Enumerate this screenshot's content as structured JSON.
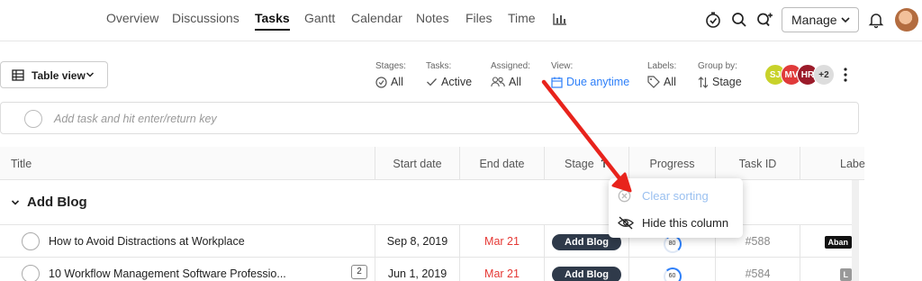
{
  "nav": {
    "tabs": [
      {
        "label": "Overview"
      },
      {
        "label": "Discussions"
      },
      {
        "label": "Tasks"
      },
      {
        "label": "Gantt"
      },
      {
        "label": "Calendar"
      },
      {
        "label": "Notes"
      },
      {
        "label": "Files"
      },
      {
        "label": "Time"
      }
    ],
    "active_tab": "Tasks",
    "manage_label": "Manage"
  },
  "toolbar": {
    "view_button": "Table view",
    "filters": [
      {
        "label": "Stages:",
        "value": "All",
        "icon": "check-circle-icon"
      },
      {
        "label": "Tasks:",
        "value": "Active",
        "icon": "check-icon"
      },
      {
        "label": "Assigned:",
        "value": "All",
        "icon": "users-icon"
      },
      {
        "label": "View:",
        "value": "Due anytime",
        "icon": "calendar-icon"
      },
      {
        "label": "Labels:",
        "value": "All",
        "icon": "tag-icon"
      },
      {
        "label": "Group by:",
        "value": "Stage",
        "icon": "sort-icon"
      }
    ],
    "avatars": [
      {
        "initials": "SJ",
        "color": "#c8d22a"
      },
      {
        "initials": "MV",
        "color": "#e03a3a"
      },
      {
        "initials": "HR",
        "color": "#9b1b2a"
      },
      {
        "initials": "+2",
        "color": "#dddddd"
      }
    ]
  },
  "add_task": {
    "placeholder": "Add task and hit enter/return key"
  },
  "table": {
    "headers": [
      "Title",
      "Start date",
      "End date",
      "Stage",
      "Progress",
      "Task ID",
      "Labe"
    ],
    "group": {
      "title": "Add Blog"
    },
    "rows": [
      {
        "title": "How to Avoid Distractions at Workplace",
        "start": "Sep 8, 2019",
        "end": "Mar 21",
        "stage": "Add Blog",
        "progress": "80",
        "task_id": "#588",
        "label": "Aban",
        "comments": ""
      },
      {
        "title": "10 Workflow Management Software Professio...",
        "start": "Jun 1, 2019",
        "end": "Mar 21",
        "stage": "Add Blog",
        "progress": "60",
        "task_id": "#584",
        "label": "L",
        "comments": "2"
      }
    ]
  },
  "popup": {
    "items": [
      {
        "label": "Clear sorting",
        "icon": "close-circle-icon",
        "disabled": true
      },
      {
        "label": "Hide this column",
        "icon": "eye-off-icon",
        "disabled": false
      }
    ]
  },
  "colors": {
    "accent": "#2d7ff9",
    "danger": "#e53935",
    "stage_pill": "#2f3a4a",
    "arrow": "#e8231c"
  }
}
